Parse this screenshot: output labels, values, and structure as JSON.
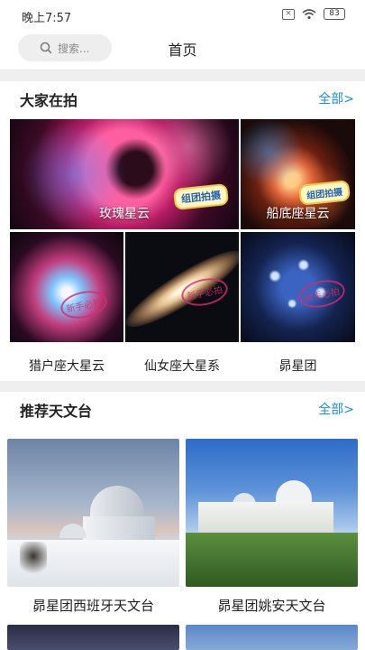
{
  "status_bar": {
    "time": "晚上7:57",
    "battery": "83"
  },
  "header": {
    "search_placeholder": "搜索...",
    "title": "首页"
  },
  "popular": {
    "title": "大家在拍",
    "more": "全部>",
    "tiles": [
      {
        "name": "玫瑰星云",
        "badge": "组团拍摄"
      },
      {
        "name": "船底座星云",
        "badge": "组团拍摄"
      },
      {
        "name": "猎户座大星云",
        "badge": "新手必拍"
      },
      {
        "name": "仙女座大星系",
        "badge": "新手必拍"
      },
      {
        "name": "昴星团",
        "badge": "新手必拍"
      }
    ]
  },
  "observatories": {
    "title": "推荐天文台",
    "more": "全部>",
    "items": [
      {
        "name": "昴星团西班牙天文台"
      },
      {
        "name": "昴星团姚安天文台"
      }
    ]
  },
  "colors": {
    "accent": "#1a8fd6",
    "stamp": "#d12d6d",
    "badge_text": "#1f63b5"
  }
}
